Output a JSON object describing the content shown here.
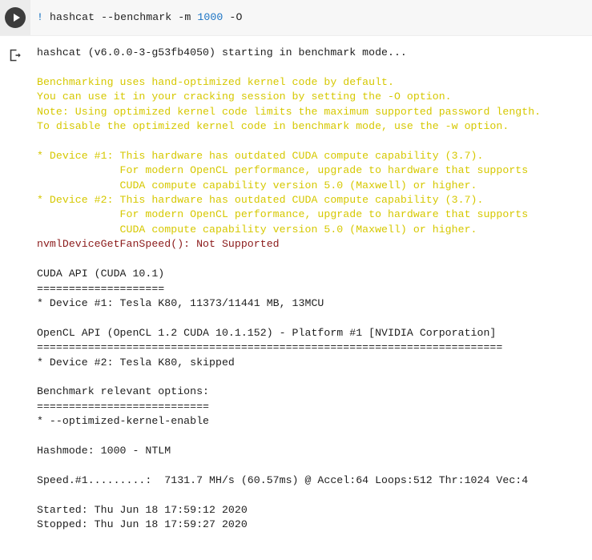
{
  "cell": {
    "run_button_label": "Run cell",
    "run_icon": "play-icon",
    "output_icon": "output-stream-icon",
    "code": {
      "bang": "!",
      "command": " hashcat --benchmark -m ",
      "mode": "1000",
      "flags": " -O",
      "full": "! hashcat --benchmark -m 1000 -O"
    }
  },
  "output": {
    "lines": [
      {
        "text": "hashcat (v6.0.0-3-g53fb4050) starting in benchmark mode...",
        "color": "black"
      },
      {
        "text": "",
        "color": "black"
      },
      {
        "text": "Benchmarking uses hand-optimized kernel code by default.",
        "color": "yellow"
      },
      {
        "text": "You can use it in your cracking session by setting the -O option.",
        "color": "yellow"
      },
      {
        "text": "Note: Using optimized kernel code limits the maximum supported password length.",
        "color": "yellow"
      },
      {
        "text": "To disable the optimized kernel code in benchmark mode, use the -w option.",
        "color": "yellow"
      },
      {
        "text": "",
        "color": "yellow"
      },
      {
        "text": "* Device #1: This hardware has outdated CUDA compute capability (3.7).",
        "color": "yellow"
      },
      {
        "text": "             For modern OpenCL performance, upgrade to hardware that supports",
        "color": "yellow"
      },
      {
        "text": "             CUDA compute capability version 5.0 (Maxwell) or higher.",
        "color": "yellow"
      },
      {
        "text": "* Device #2: This hardware has outdated CUDA compute capability (3.7).",
        "color": "yellow"
      },
      {
        "text": "             For modern OpenCL performance, upgrade to hardware that supports",
        "color": "yellow"
      },
      {
        "text": "             CUDA compute capability version 5.0 (Maxwell) or higher.",
        "color": "yellow"
      },
      {
        "text": "nvmlDeviceGetFanSpeed(): Not Supported",
        "color": "red"
      },
      {
        "text": "",
        "color": "black"
      },
      {
        "text": "CUDA API (CUDA 10.1)",
        "color": "black"
      },
      {
        "text": "====================",
        "color": "black"
      },
      {
        "text": "* Device #1: Tesla K80, 11373/11441 MB, 13MCU",
        "color": "black"
      },
      {
        "text": "",
        "color": "black"
      },
      {
        "text": "OpenCL API (OpenCL 1.2 CUDA 10.1.152) - Platform #1 [NVIDIA Corporation]",
        "color": "black"
      },
      {
        "text": "=========================================================================",
        "color": "black"
      },
      {
        "text": "* Device #2: Tesla K80, skipped",
        "color": "black"
      },
      {
        "text": "",
        "color": "black"
      },
      {
        "text": "Benchmark relevant options:",
        "color": "black"
      },
      {
        "text": "===========================",
        "color": "black"
      },
      {
        "text": "* --optimized-kernel-enable",
        "color": "black"
      },
      {
        "text": "",
        "color": "black"
      },
      {
        "text": "Hashmode: 1000 - NTLM",
        "color": "black"
      },
      {
        "text": "",
        "color": "black"
      },
      {
        "text": "Speed.#1.........:  7131.7 MH/s (60.57ms) @ Accel:64 Loops:512 Thr:1024 Vec:4",
        "color": "black"
      },
      {
        "text": "",
        "color": "black"
      },
      {
        "text": "Started: Thu Jun 18 17:59:12 2020",
        "color": "black"
      },
      {
        "text": "Stopped: Thu Jun 18 17:59:27 2020",
        "color": "black"
      }
    ],
    "benchmark": {
      "hashcat_version": "v6.0.0-3-g53fb4050",
      "mode": "benchmark mode",
      "cuda_api_version": "CUDA 10.1",
      "opencl_api_version": "OpenCL 1.2 CUDA 10.1.152",
      "opencl_platform": "Platform #1 [NVIDIA Corporation]",
      "device1": "Tesla K80, 11373/11441 MB, 13MCU",
      "device2": "Tesla K80, skipped",
      "hashmode_id": "1000",
      "hashmode_name": "NTLM",
      "speed": "7131.7 MH/s",
      "speed_time": "60.57ms",
      "accel": "64",
      "loops": "512",
      "thr": "1024",
      "vec": "4",
      "started": "Thu Jun 18 17:59:12 2020",
      "stopped": "Thu Jun 18 17:59:27 2020"
    }
  },
  "colors": {
    "stdout": "#202020",
    "warning": "#d6c800",
    "stderr": "#8b1a1a",
    "code_bg": "#f7f7f7",
    "gutter_bg": "#ececec",
    "run_button": "#3c3c3c",
    "code_number": "#1a73c4",
    "code_bang": "#0b6cbf"
  }
}
